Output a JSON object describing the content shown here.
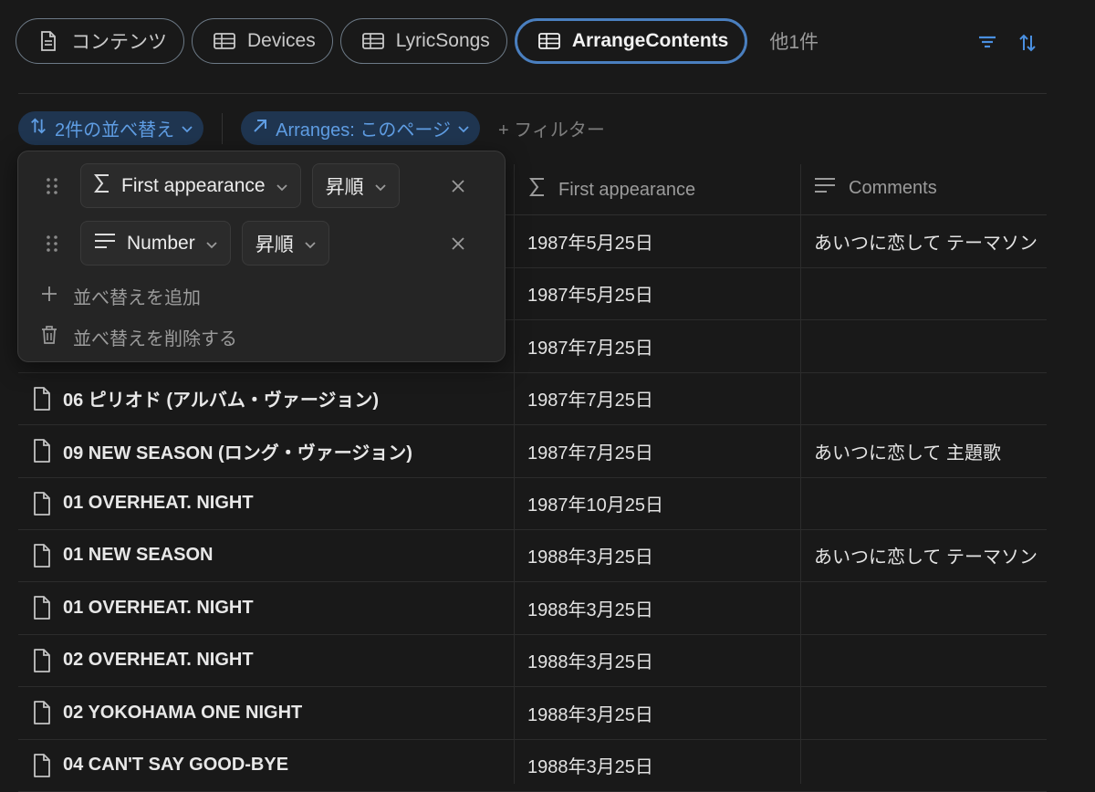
{
  "tabs": [
    {
      "label": "コンテンツ",
      "icon": "document-icon"
    },
    {
      "label": "Devices",
      "icon": "table-icon"
    },
    {
      "label": "LyricSongs",
      "icon": "table-icon"
    },
    {
      "label": "ArrangeContents",
      "icon": "table-icon",
      "active": true
    }
  ],
  "more_tabs": "他1件",
  "toolbar": {
    "sort_chip": "2件の並べ替え",
    "relation_chip": "Arranges: このページ",
    "add_filter": "+ フィルター"
  },
  "columns": {
    "first_appearance": "First appearance",
    "comments": "Comments"
  },
  "sort_popover": {
    "rules": [
      {
        "property": "First appearance",
        "property_icon": "sigma-icon",
        "direction": "昇順"
      },
      {
        "property": "Number",
        "property_icon": "text-lines-icon",
        "direction": "昇順"
      }
    ],
    "add_sort": "並べ替えを追加",
    "delete_sort": "並べ替えを削除する"
  },
  "rows": [
    {
      "title": "",
      "date": "1987年5月25日",
      "comment": "あいつに恋して テーマソン"
    },
    {
      "title": "",
      "date": "1987年5月25日",
      "comment": ""
    },
    {
      "title": "",
      "date": "1987年7月25日",
      "comment": ""
    },
    {
      "title": "06 ピリオド (アルバム・ヴァージョン)",
      "date": "1987年7月25日",
      "comment": ""
    },
    {
      "title": "09 NEW SEASON (ロング・ヴァージョン)",
      "date": "1987年7月25日",
      "comment": "あいつに恋して 主題歌"
    },
    {
      "title": "01 OVERHEAT. NIGHT",
      "date": "1987年10月25日",
      "comment": ""
    },
    {
      "title": "01 NEW SEASON",
      "date": "1988年3月25日",
      "comment": "あいつに恋して テーマソン"
    },
    {
      "title": "01 OVERHEAT. NIGHT",
      "date": "1988年3月25日",
      "comment": ""
    },
    {
      "title": "02 OVERHEAT. NIGHT",
      "date": "1988年3月25日",
      "comment": ""
    },
    {
      "title": "02 YOKOHAMA ONE NIGHT",
      "date": "1988年3月25日",
      "comment": ""
    },
    {
      "title": "04 CAN'T SAY GOOD-BYE",
      "date": "1988年3月25日",
      "comment": ""
    }
  ],
  "colors": {
    "accent": "#4a7fbf",
    "chip_bg": "#1f3550",
    "chip_text": "#5f9de3",
    "background": "#191919"
  }
}
